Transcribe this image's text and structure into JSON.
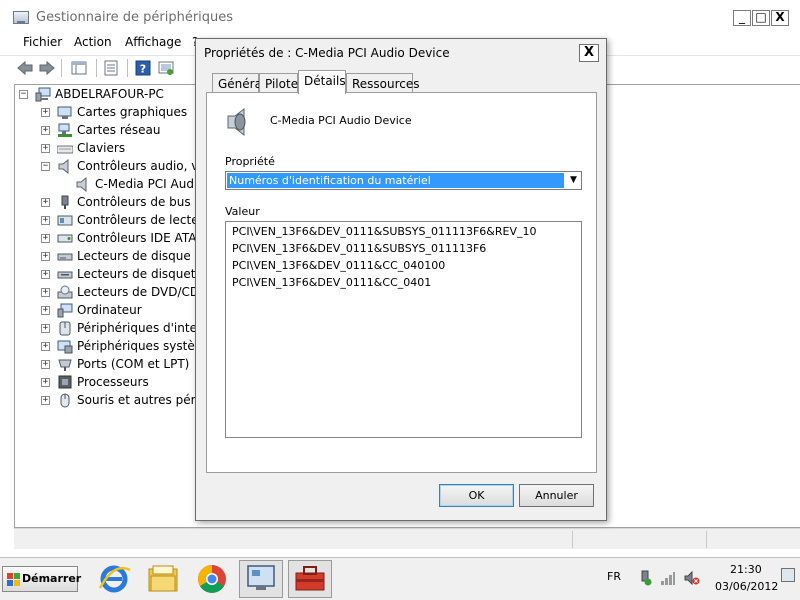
{
  "main_window": {
    "title": "Gestionnaire de périphériques",
    "caption": {
      "minimize": "_",
      "maximize": "□",
      "close": "X"
    },
    "menu": [
      "Fichier",
      "Action",
      "Affichage",
      "?"
    ],
    "tree": {
      "root": "ABDELRAFOUR-PC",
      "items": [
        {
          "label": "Cartes graphiques",
          "expander": "+"
        },
        {
          "label": "Cartes réseau",
          "expander": "+"
        },
        {
          "label": "Claviers",
          "expander": "+"
        },
        {
          "label": "Contrôleurs audio, vid",
          "expander": "−"
        },
        {
          "label": "C-Media PCI Audic",
          "expander": ""
        },
        {
          "label": "Contrôleurs de bus US",
          "expander": "+"
        },
        {
          "label": "Contrôleurs de lecteur",
          "expander": "+"
        },
        {
          "label": "Contrôleurs IDE ATA/A",
          "expander": "+"
        },
        {
          "label": "Lecteurs de disque",
          "expander": "+"
        },
        {
          "label": "Lecteurs de disquette",
          "expander": "+"
        },
        {
          "label": "Lecteurs de DVD/CD-R",
          "expander": "+"
        },
        {
          "label": "Ordinateur",
          "expander": "+"
        },
        {
          "label": "Périphériques d'interfa",
          "expander": "+"
        },
        {
          "label": "Périphériques système",
          "expander": "+"
        },
        {
          "label": "Ports (COM et LPT)",
          "expander": "+"
        },
        {
          "label": "Processeurs",
          "expander": "+"
        },
        {
          "label": "Souris et autres périph",
          "expander": "+"
        }
      ]
    }
  },
  "dialog": {
    "title": "Propriétés de : C-Media PCI Audio Device",
    "close": "X",
    "tabs": [
      "Général",
      "Pilote",
      "Détails",
      "Ressources"
    ],
    "active_tab": "Détails",
    "device_name": "C-Media PCI Audio Device",
    "property_label": "Propriété",
    "property_value": "Numéros d'identification du matériel",
    "value_label": "Valeur",
    "values": [
      "PCI\\VEN_13F6&DEV_0111&SUBSYS_011113F6&REV_10",
      "PCI\\VEN_13F6&DEV_0111&SUBSYS_011113F6",
      "PCI\\VEN_13F6&DEV_0111&CC_040100",
      "PCI\\VEN_13F6&DEV_0111&CC_0401"
    ],
    "ok_label": "OK",
    "cancel_label": "Annuler"
  },
  "taskbar": {
    "start_label": "Démarrer",
    "language": "FR",
    "time": "21:30",
    "date": "03/06/2012"
  },
  "colors": {
    "selection": "#3399ff",
    "dialog_bg": "#f0f0f0"
  }
}
